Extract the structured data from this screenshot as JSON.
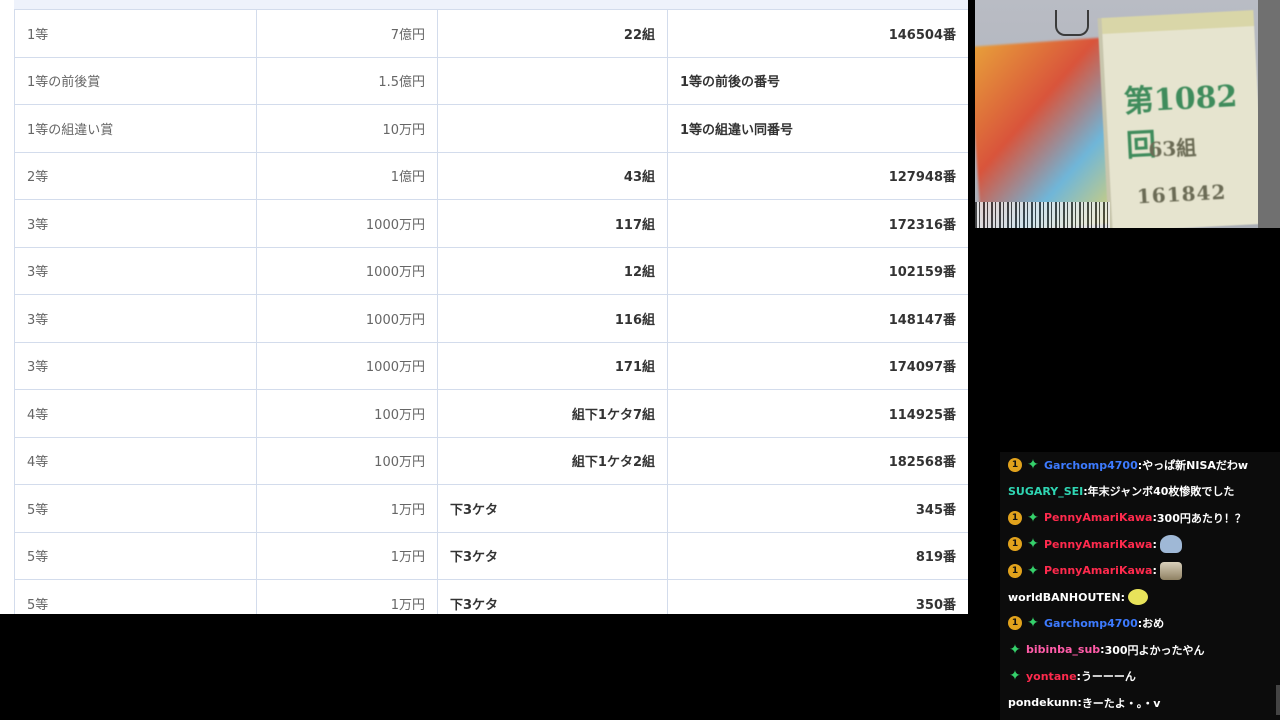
{
  "results_table": {
    "rows": [
      {
        "grade": "1等",
        "amount": "7億円",
        "group": "22組",
        "group_align": "right",
        "number": "146504番",
        "number_align": "right"
      },
      {
        "grade": "1等の前後賞",
        "amount": "1.5億円",
        "group": "",
        "group_align": "right",
        "number": "1等の前後の番号",
        "number_align": "left"
      },
      {
        "grade": "1等の組違い賞",
        "amount": "10万円",
        "group": "",
        "group_align": "right",
        "number": "1等の組違い同番号",
        "number_align": "left"
      },
      {
        "grade": "2等",
        "amount": "1億円",
        "group": "43組",
        "group_align": "right",
        "number": "127948番",
        "number_align": "right"
      },
      {
        "grade": "3等",
        "amount": "1000万円",
        "group": "117組",
        "group_align": "right",
        "number": "172316番",
        "number_align": "right"
      },
      {
        "grade": "3等",
        "amount": "1000万円",
        "group": "12組",
        "group_align": "right",
        "number": "102159番",
        "number_align": "right"
      },
      {
        "grade": "3等",
        "amount": "1000万円",
        "group": "116組",
        "group_align": "right",
        "number": "148147番",
        "number_align": "right"
      },
      {
        "grade": "3等",
        "amount": "1000万円",
        "group": "171組",
        "group_align": "right",
        "number": "174097番",
        "number_align": "right"
      },
      {
        "grade": "4等",
        "amount": "100万円",
        "group": "組下1ケタ7組",
        "group_align": "right",
        "number": "114925番",
        "number_align": "right"
      },
      {
        "grade": "4等",
        "amount": "100万円",
        "group": "組下1ケタ2組",
        "group_align": "right",
        "number": "182568番",
        "number_align": "right"
      },
      {
        "grade": "5等",
        "amount": "1万円",
        "group": "下3ケタ",
        "group_align": "left",
        "number": "345番",
        "number_align": "right"
      },
      {
        "grade": "5等",
        "amount": "1万円",
        "group": "下3ケタ",
        "group_align": "left",
        "number": "819番",
        "number_align": "right"
      },
      {
        "grade": "5等",
        "amount": "1万円",
        "group": "下3ケタ",
        "group_align": "left",
        "number": "350番",
        "number_align": "right"
      }
    ]
  },
  "webcam": {
    "ticket_round": "第1082回",
    "ticket_group": "63組",
    "ticket_number": "161842"
  },
  "chat": {
    "messages": [
      {
        "user": "Garchomp4700",
        "color": "#3d7bff",
        "sub_badge": "1",
        "vip": true,
        "text": "やっぱ新NISAだわw",
        "emote": ""
      },
      {
        "user": "SUGARY_SEI",
        "color": "#2fd6b3",
        "sub_badge": "",
        "vip": false,
        "text": "年末ジャンボ40枚惨敗でした",
        "emote": ""
      },
      {
        "user": "PennyAmariKawa",
        "color": "#ff2a4d",
        "sub_badge": "1",
        "vip": true,
        "text": "300円あたり！？",
        "emote": ""
      },
      {
        "user": "PennyAmariKawa",
        "color": "#ff2a4d",
        "sub_badge": "1",
        "vip": true,
        "text": "",
        "emote": "ghost"
      },
      {
        "user": "PennyAmariKawa",
        "color": "#ff2a4d",
        "sub_badge": "1",
        "vip": true,
        "text": "",
        "emote": "cat"
      },
      {
        "user": "worldBANHOUTEN",
        "color": "#ffffff",
        "sub_badge": "",
        "vip": false,
        "text": "",
        "emote": "bird"
      },
      {
        "user": "Garchomp4700",
        "color": "#3d7bff",
        "sub_badge": "1",
        "vip": true,
        "text": "おめ",
        "emote": ""
      },
      {
        "user": "bibinba_sub",
        "color": "#ff5ca8",
        "sub_badge": "",
        "vip": true,
        "text": "300円よかったやん",
        "emote": ""
      },
      {
        "user": "yontane",
        "color": "#ff2a4d",
        "sub_badge": "",
        "vip": true,
        "text": "うーーーん",
        "emote": ""
      },
      {
        "user": "pondekunn",
        "color": "#ffffff",
        "sub_badge": "",
        "vip": false,
        "text": "きーたよ・。・v",
        "emote": ""
      }
    ]
  }
}
